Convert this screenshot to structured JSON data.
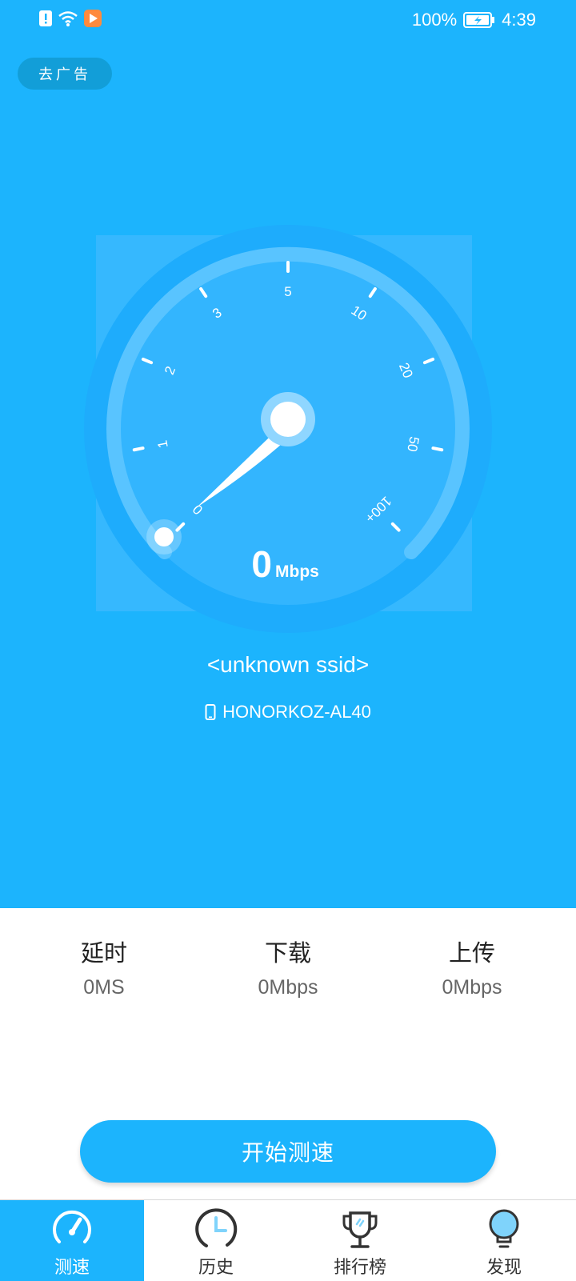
{
  "status_bar": {
    "battery": "100%",
    "time": "4:39"
  },
  "ad_button": {
    "label": "去广告"
  },
  "gauge": {
    "speed_value": "0",
    "speed_unit": "Mbps",
    "scale_labels": [
      "0",
      "1",
      "2",
      "3",
      "5",
      "10",
      "20",
      "50",
      "100+"
    ],
    "current_speed": 0
  },
  "network": {
    "ssid": "<unknown ssid>",
    "device": "HONORKOZ-AL40"
  },
  "stats": [
    {
      "label": "延时",
      "value": "0MS"
    },
    {
      "label": "下载",
      "value": "0Mbps"
    },
    {
      "label": "上传",
      "value": "0Mbps"
    }
  ],
  "start_button": {
    "label": "开始测速"
  },
  "tabs": [
    {
      "label": "测速",
      "icon": "speedometer-icon",
      "active": true
    },
    {
      "label": "历史",
      "icon": "clock-icon",
      "active": false
    },
    {
      "label": "排行榜",
      "icon": "trophy-icon",
      "active": false
    },
    {
      "label": "发现",
      "icon": "lightbulb-icon",
      "active": false
    }
  ],
  "colors": {
    "primary": "#1cb4fd",
    "white": "#ffffff"
  }
}
